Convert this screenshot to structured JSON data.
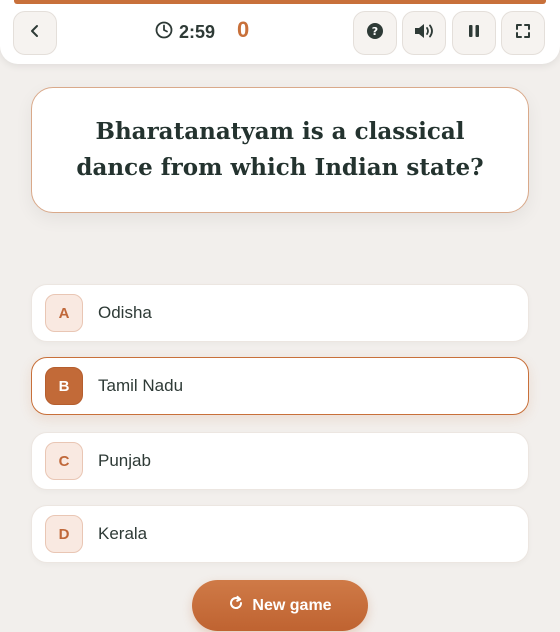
{
  "header": {
    "timer": "2:59",
    "score": "0",
    "icons": {
      "back": "chevron-left-icon",
      "clock": "clock-icon",
      "help": "help-icon",
      "sound": "speaker-icon",
      "pause": "pause-icon",
      "fullscreen": "fullscreen-icon"
    }
  },
  "question": {
    "text": "Bharatanatyam is a classical dance from which Indian state?"
  },
  "answers": [
    {
      "letter": "A",
      "label": "Odisha",
      "selected": false
    },
    {
      "letter": "B",
      "label": "Tamil Nadu",
      "selected": true
    },
    {
      "letter": "C",
      "label": "Punjab",
      "selected": false
    },
    {
      "letter": "D",
      "label": "Kerala",
      "selected": false
    }
  ],
  "actions": {
    "new_game_label": "New game",
    "new_game_icon": "restart-icon"
  },
  "colors": {
    "accent": "#c8703a",
    "background": "#f2efec",
    "text": "#2e3a36"
  }
}
